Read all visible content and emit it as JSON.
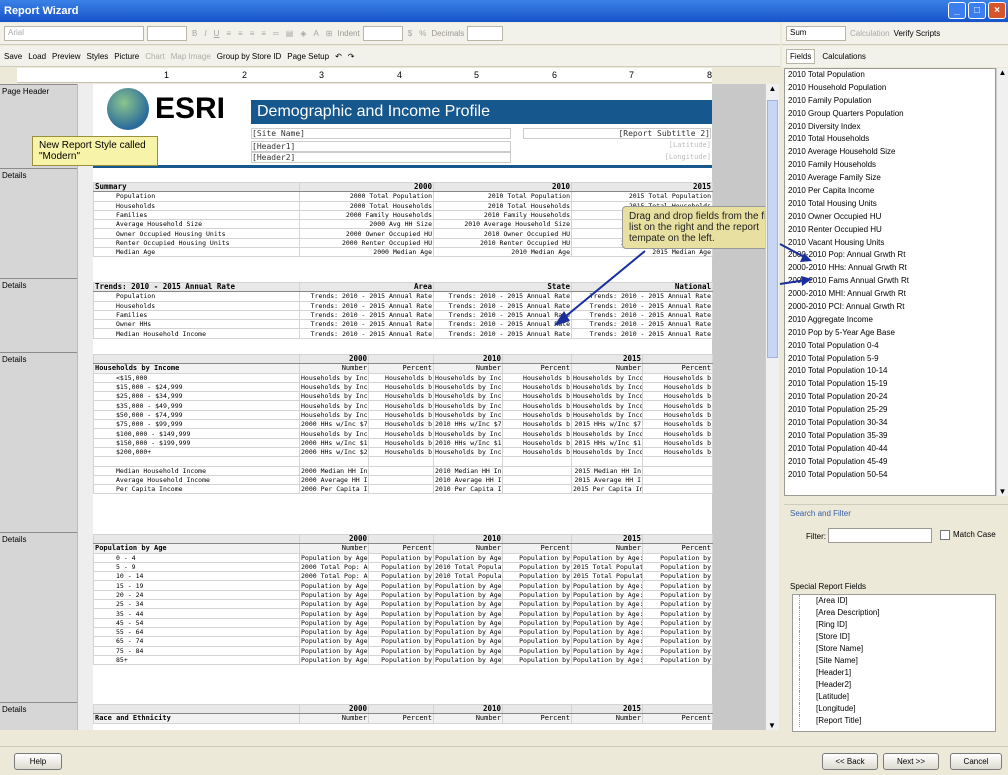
{
  "window": {
    "title": "Report Wizard"
  },
  "toolbar1": {
    "font": "Arial",
    "indent_label": "Indent",
    "decimals_label": "Decimals",
    "sum": "Sum",
    "calculation": "Calculation",
    "verify_scripts": "Verify Scripts"
  },
  "toolbar2": {
    "save": "Save",
    "load": "Load",
    "preview": "Preview",
    "styles": "Styles",
    "picture": "Picture",
    "chart": "Chart",
    "map_image": "Map Image",
    "group_by": "Group by Store ID",
    "page_setup": "Page Setup"
  },
  "right_tabs": {
    "fields": "Fields",
    "calculations": "Calculations"
  },
  "ruler": [
    "1",
    "2",
    "3",
    "4",
    "5",
    "6",
    "7",
    "8"
  ],
  "bands": {
    "page_header": "Page Header",
    "details": "Details"
  },
  "report_header": {
    "logo": "ESRI",
    "title": "Demographic and Income Profile",
    "site_name": "[Site Name]",
    "header1": "[Header1]",
    "header2": "[Header2]",
    "subtitle": "[Report Subtitle 2]",
    "latitude": "[Latitude]",
    "longitude": "[Longitude]"
  },
  "callouts": {
    "modern": "New Report Style called \"Modern\"",
    "drag": "Drag and drop fields from the fields list on the right and the report tempate on the left."
  },
  "summary": {
    "header": [
      "Summary",
      "2000",
      "2010",
      "2015"
    ],
    "rows": [
      [
        "Population",
        "2000 Total Population",
        "2010 Total Population",
        "2015 Total Population"
      ],
      [
        "Households",
        "2000 Total Households",
        "2010 Total Households",
        "2015 Total Households"
      ],
      [
        "Families",
        "2000 Family Households",
        "2010 Family Households",
        "2015 Family Households"
      ],
      [
        "Average Household Size",
        "2000 Avg HH Size",
        "2010 Average Household Size",
        "2015 Average HH Size"
      ],
      [
        "Owner Occupied Housing Units",
        "2000 Owner Occupied HU",
        "2010 Owner Occupied HU",
        "2015 Owner Occupied HU"
      ],
      [
        "Renter Occupied Housing Units",
        "2000 Renter Occupied HU",
        "2010 Renter Occupied HU",
        "2015 Renter Occupied HU"
      ],
      [
        "Median Age",
        "2000 Median Age",
        "2010 Median Age",
        "2015 Median Age"
      ]
    ]
  },
  "trends": {
    "header": [
      "Trends: 2010 - 2015 Annual Rate",
      "Area",
      "State",
      "National"
    ],
    "rows": [
      [
        "Population",
        "Trends: 2010 - 2015 Annual Rate",
        "Trends: 2010 - 2015 Annual Rate",
        "Trends: 2010 - 2015 Annual Rate"
      ],
      [
        "Households",
        "Trends: 2010 - 2015 Annual Rate",
        "Trends: 2010 - 2015 Annual Rate",
        "Trends: 2010 - 2015 Annual Rate"
      ],
      [
        "Families",
        "Trends: 2010 - 2015 Annual Rate",
        "Trends: 2010 - 2015 Annual Rate",
        "Trends: 2010 - 2015 Annual Rate"
      ],
      [
        "Owner HHs",
        "Trends: 2010 - 2015 Annual Rate",
        "Trends: 2010 - 2015 Annual Rate",
        "Trends: 2010 - 2015 Annual Rate"
      ],
      [
        "Median Household Income",
        "Trends: 2010 - 2015 Annual Rate",
        "Trends: 2010 - 2015 Annual Rate",
        "Trends: 2010 - 2015 Annual Rate"
      ]
    ]
  },
  "income": {
    "years": [
      "",
      "2000",
      "",
      "2010",
      "",
      "2015",
      ""
    ],
    "header": [
      "Households by Income",
      "Number",
      "Percent",
      "Number",
      "Percent",
      "Number",
      "Percent"
    ],
    "rows": [
      [
        "<$15,000",
        "Households by Inco",
        "Households b",
        "Households by Inco",
        "Households b",
        "Households by Inco",
        "Households b"
      ],
      [
        "$15,000 - $24,999",
        "Households by Inco",
        "Households b",
        "Households by Inco",
        "Households b",
        "Households by Inco",
        "Households b"
      ],
      [
        "$25,000 - $34,999",
        "Households by Inco",
        "Households b",
        "Households by Inco",
        "Households b",
        "Households by Inco",
        "Households b"
      ],
      [
        "$35,000 - $49,999",
        "Households by Inco",
        "Households b",
        "Households by Inco",
        "Households b",
        "Households by Inco",
        "Households b"
      ],
      [
        "$50,000 - $74,999",
        "Households by Inco",
        "Households b",
        "Households by Inco",
        "Households b",
        "Households by Inco",
        "Households b"
      ],
      [
        "$75,000 - $99,999",
        "2000 HHs w/Inc $7",
        "Households b",
        "2010 HHs w/Inc $7",
        "Households b",
        "2015 HHs w/Inc $7",
        "Households b"
      ],
      [
        "$100,000 - $149,999",
        "Households by Inco",
        "Households b",
        "Households by Inco",
        "Households b",
        "Households by Inco",
        "Households b"
      ],
      [
        "$150,000 - $199,999",
        "2000 HHs w/Inc $1",
        "Households b",
        "2010 HHs w/Inc $1",
        "Households b",
        "2015 HHs w/Inc $1",
        "Households b"
      ],
      [
        "$200,000+",
        "2000 HHs w/Inc $2",
        "Households b",
        "Households by Inco",
        "Households b",
        "Households by Inco",
        "Households b"
      ],
      [
        "",
        "",
        "",
        "",
        "",
        "",
        ""
      ],
      [
        "Median Household Income",
        "2000 Median HH In",
        "",
        "2010 Median HH In",
        "",
        "2015 Median HH In",
        ""
      ],
      [
        "Average Household Income",
        "2000 Average HH I",
        "",
        "2010 Average HH I",
        "",
        "2015 Average HH I",
        ""
      ],
      [
        "Per Capita Income",
        "2000 Per Capita Inc",
        "",
        "2010 Per Capita Inc",
        "",
        "2015 Per Capita Inc",
        ""
      ]
    ]
  },
  "age": {
    "years": [
      "",
      "2000",
      "",
      "2010",
      "",
      "2015",
      ""
    ],
    "header": [
      "Population by Age",
      "Number",
      "Percent",
      "Number",
      "Percent",
      "Number",
      "Percent"
    ],
    "rows": [
      [
        "0 - 4",
        "Population by Age:",
        "Population by",
        "Population by Age:",
        "Population by",
        "Population by Age:",
        "Population by"
      ],
      [
        "5 - 9",
        "2000 Total Pop: Ag",
        "Population by",
        "2010 Total Populati",
        "Population by",
        "2015 Total Populati",
        "Population by"
      ],
      [
        "10 - 14",
        "2000 Total Pop: Ag",
        "Population by",
        "2010 Total Populati",
        "Population by",
        "2015 Total Populati",
        "Population by"
      ],
      [
        "15 - 19",
        "Population by Age:",
        "Population by",
        "Population by Age:",
        "Population by",
        "Population by Age:",
        "Population by"
      ],
      [
        "20 - 24",
        "Population by Age:",
        "Population by",
        "Population by Age:",
        "Population by",
        "Population by Age:",
        "Population by"
      ],
      [
        "25 - 34",
        "Population by Age:",
        "Population by",
        "Population by Age:",
        "Population by",
        "Population by Age:",
        "Population by"
      ],
      [
        "35 - 44",
        "Population by Age:",
        "Population by",
        "Population by Age:",
        "Population by",
        "Population by Age:",
        "Population by"
      ],
      [
        "45 - 54",
        "Population by Age:",
        "Population by",
        "Population by Age:",
        "Population by",
        "Population by Age:",
        "Population by"
      ],
      [
        "55 - 64",
        "Population by Age:",
        "Population by",
        "Population by Age:",
        "Population by",
        "Population by Age:",
        "Population by"
      ],
      [
        "65 - 74",
        "Population by Age:",
        "Population by",
        "Population by Age:",
        "Population by",
        "Population by Age:",
        "Population by"
      ],
      [
        "75 - 84",
        "Population by Age:",
        "Population by",
        "Population by Age:",
        "Population by",
        "Population by Age:",
        "Population by"
      ],
      [
        "85+",
        "Population by Age:",
        "Population by",
        "Population by Age:",
        "Population by",
        "Population by Age:",
        "Population by"
      ]
    ]
  },
  "race": {
    "years": [
      "",
      "2000",
      "",
      "2010",
      "",
      "2015",
      ""
    ],
    "header": [
      "Race and Ethnicity",
      "Number",
      "Percent",
      "Number",
      "Percent",
      "Number",
      "Percent"
    ]
  },
  "fields": [
    "2010 Total Population",
    "2010 Household Population",
    "2010 Family Population",
    "2010 Group Quarters Population",
    "2010 Diversity Index",
    "2010 Total Households",
    "2010 Average Household Size",
    "2010 Family Households",
    "2010 Average Family Size",
    "2010 Per Capita Income",
    "2010 Total Housing Units",
    "2010 Owner Occupied HU",
    "2010 Renter Occupied HU",
    "2010 Vacant Housing Units",
    "2000-2010 Pop: Annual Grwth Rt",
    "2000-2010 HHs: Annual Grwth Rt",
    "2000-2010 Fams Annual Grwth Rt",
    "2000-2010 MHI: Annual Grwth Rt",
    "2000-2010 PCI: Annual Grwth Rt",
    "2010 Aggregate Income",
    "2010 Pop by 5-Year Age Base",
    "2010 Total Population 0-4",
    "2010 Total Population 5-9",
    "2010 Total Population 10-14",
    "2010 Total Population 15-19",
    "2010 Total Population 20-24",
    "2010 Total Population 25-29",
    "2010 Total Population 30-34",
    "2010 Total Population 35-39",
    "2010 Total Population 40-44",
    "2010 Total Population 45-49",
    "2010 Total Population 50-54"
  ],
  "search": {
    "title": "Search and Filter",
    "filter_label": "Filter:",
    "filter_value": "",
    "match_case": "Match Case"
  },
  "special": {
    "title": "Special Report Fields",
    "items": [
      "[Area ID]",
      "[Area Description]",
      "[Ring ID]",
      "[Store ID]",
      "[Store Name]",
      "[Site Name]",
      "[Header1]",
      "[Header2]",
      "[Latitude]",
      "[Longitude]",
      "[Report Title]"
    ]
  },
  "buttons": {
    "help": "Help",
    "back": "<< Back",
    "next": "Next >>",
    "cancel": "Cancel"
  }
}
